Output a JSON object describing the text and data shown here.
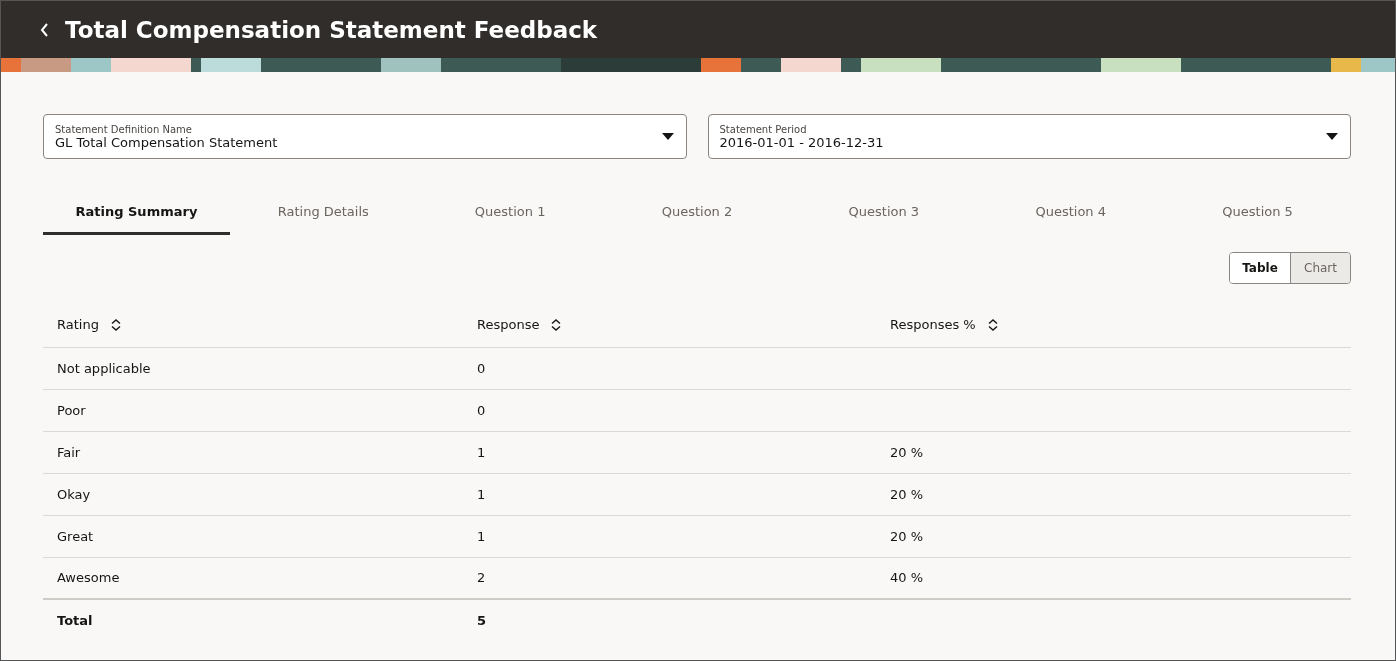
{
  "header": {
    "title": "Total Compensation Statement Feedback"
  },
  "filters": [
    {
      "label": "Statement Definition Name",
      "value": "GL Total Compensation Statement"
    },
    {
      "label": "Statement Period",
      "value": "2016-01-01 - 2016-12-31"
    }
  ],
  "tabs": [
    {
      "label": "Rating Summary",
      "selected": true
    },
    {
      "label": "Rating Details",
      "selected": false
    },
    {
      "label": "Question 1",
      "selected": false
    },
    {
      "label": "Question 2",
      "selected": false
    },
    {
      "label": "Question 3",
      "selected": false
    },
    {
      "label": "Question 4",
      "selected": false
    },
    {
      "label": "Question 5",
      "selected": false
    }
  ],
  "view_toggle": [
    {
      "label": "Table",
      "selected": true
    },
    {
      "label": "Chart",
      "selected": false
    }
  ],
  "table": {
    "columns": [
      "Rating",
      "Response",
      "Responses %"
    ],
    "rows": [
      [
        "Not applicable",
        "0",
        ""
      ],
      [
        "Poor",
        "0",
        ""
      ],
      [
        "Fair",
        "1",
        "20 %"
      ],
      [
        "Okay",
        "1",
        "20 %"
      ],
      [
        "Great",
        "1",
        "20 %"
      ],
      [
        "Awesome",
        "2",
        "40 %"
      ]
    ],
    "total": [
      "Total",
      "5"
    ]
  }
}
